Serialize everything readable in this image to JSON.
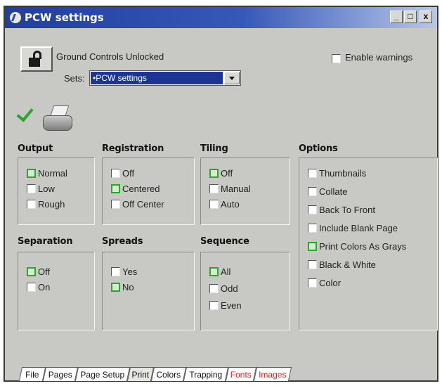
{
  "window": {
    "title": "PCW settings",
    "controls": {
      "minimize": "_",
      "maximize": "□",
      "close": "x"
    }
  },
  "header": {
    "lock_state_label": "Ground Controls Unlocked",
    "sets_label": "Sets:",
    "sets_value": "•PCW settings",
    "enable_warnings_label": "Enable warnings",
    "enable_warnings_checked": false
  },
  "groups": {
    "output": {
      "title": "Output",
      "options": [
        {
          "label": "Normal",
          "checked": true
        },
        {
          "label": "Low",
          "checked": false
        },
        {
          "label": "Rough",
          "checked": false
        }
      ]
    },
    "registration": {
      "title": "Registration",
      "options": [
        {
          "label": "Off",
          "checked": false
        },
        {
          "label": "Centered",
          "checked": true
        },
        {
          "label": "Off Center",
          "checked": false
        }
      ]
    },
    "tiling": {
      "title": "Tiling",
      "options": [
        {
          "label": "Off",
          "checked": true
        },
        {
          "label": "Manual",
          "checked": false
        },
        {
          "label": "Auto",
          "checked": false
        }
      ]
    },
    "options": {
      "title": "Options",
      "options": [
        {
          "label": "Thumbnails",
          "checked": false
        },
        {
          "label": "Collate",
          "checked": false
        },
        {
          "label": "Back To Front",
          "checked": false
        },
        {
          "label": "Include Blank Page",
          "checked": false
        },
        {
          "label": "Print Colors As Grays",
          "checked": true
        },
        {
          "label": "Black & White",
          "checked": false
        },
        {
          "label": "Color",
          "checked": false
        }
      ]
    },
    "separation": {
      "title": "Separation",
      "options": [
        {
          "label": "Off",
          "checked": true
        },
        {
          "label": "On",
          "checked": false
        }
      ]
    },
    "spreads": {
      "title": "Spreads",
      "options": [
        {
          "label": "Yes",
          "checked": false
        },
        {
          "label": "No",
          "checked": true
        }
      ]
    },
    "sequence": {
      "title": "Sequence",
      "options": [
        {
          "label": "All",
          "checked": true
        },
        {
          "label": "Odd",
          "checked": false
        },
        {
          "label": "Even",
          "checked": false
        }
      ]
    }
  },
  "tabs": [
    {
      "label": "File"
    },
    {
      "label": "Pages"
    },
    {
      "label": "Page Setup"
    },
    {
      "label": "Print",
      "active": true
    },
    {
      "label": "Colors"
    },
    {
      "label": "Trapping"
    },
    {
      "label": "Fonts",
      "accent": "#e02222"
    },
    {
      "label": "Images",
      "accent": "#e02222"
    }
  ],
  "colors": {
    "title_bar": "#1f3f9e",
    "checked_green": "#2fa22f",
    "tab_red": "#e02222"
  },
  "icons": [
    "app-icon",
    "lock-icon",
    "checkmark-icon",
    "printer-icon",
    "dropdown-arrow-icon"
  ]
}
